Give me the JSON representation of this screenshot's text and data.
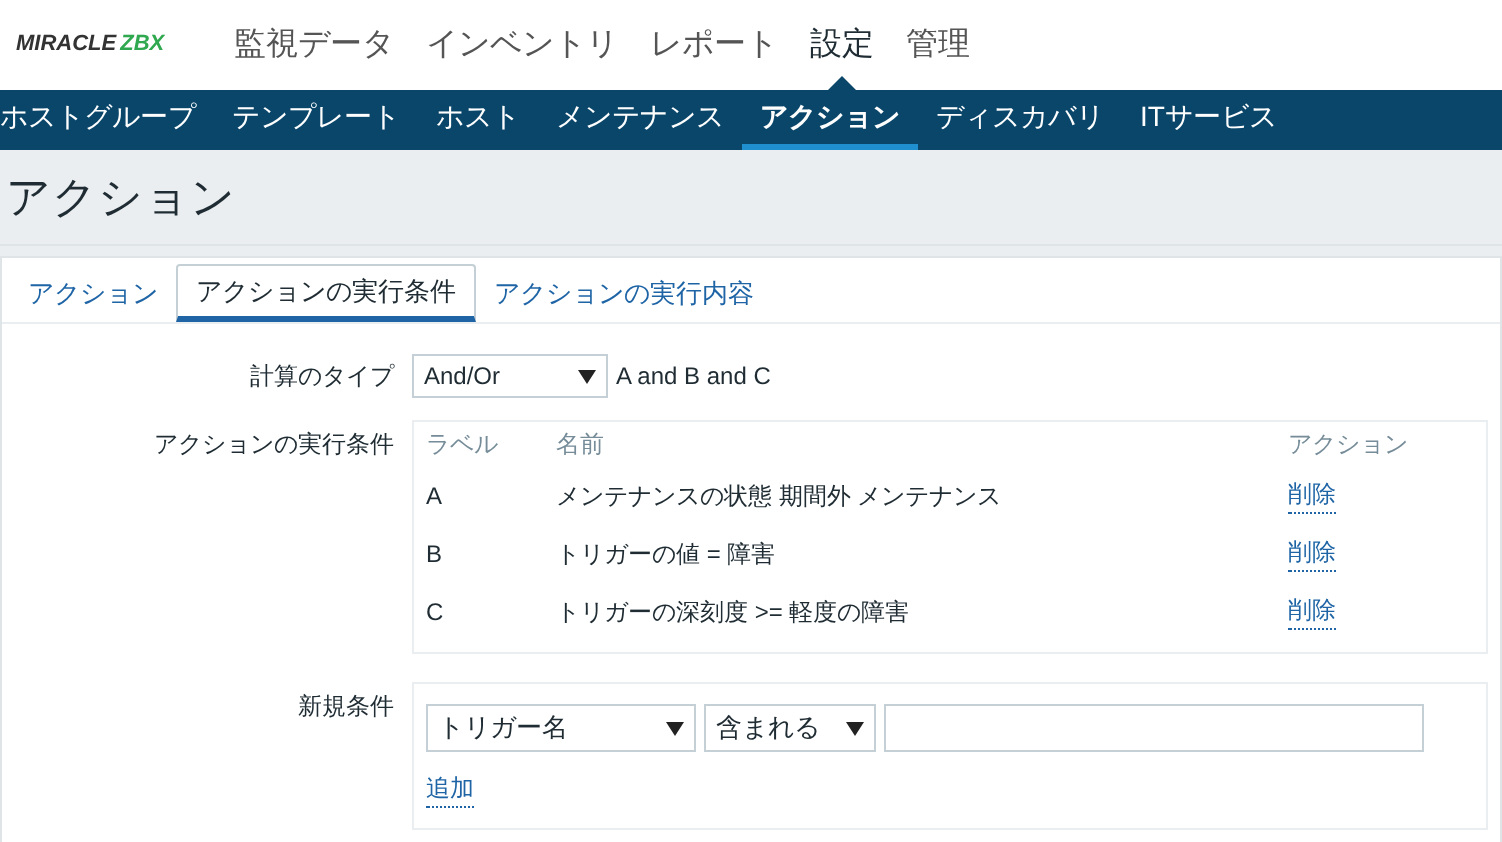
{
  "logo": {
    "part_1": "MIRACLE",
    "part_2": "ZBX"
  },
  "main_menu": [
    {
      "label": "監視データ",
      "selected": false
    },
    {
      "label": "インベントリ",
      "selected": false
    },
    {
      "label": "レポート",
      "selected": false
    },
    {
      "label": "設定",
      "selected": true
    },
    {
      "label": "管理",
      "selected": false
    }
  ],
  "sub_menu": [
    {
      "label": "ホストグループ",
      "selected": false
    },
    {
      "label": "テンプレート",
      "selected": false
    },
    {
      "label": "ホスト",
      "selected": false
    },
    {
      "label": "メンテナンス",
      "selected": false
    },
    {
      "label": "アクション",
      "selected": true
    },
    {
      "label": "ディスカバリ",
      "selected": false
    },
    {
      "label": "ITサービス",
      "selected": false
    }
  ],
  "page_title": "アクション",
  "tabs": [
    {
      "label": "アクション",
      "selected": false
    },
    {
      "label": "アクションの実行条件",
      "selected": true
    },
    {
      "label": "アクションの実行内容",
      "selected": false
    }
  ],
  "calc_type": {
    "label": "計算のタイプ",
    "value": "And/Or",
    "formula": "A and B and C"
  },
  "conditions": {
    "label": "アクションの実行条件",
    "columns": [
      "ラベル",
      "名前",
      "アクション"
    ],
    "rows": [
      {
        "label": "A",
        "name": "メンテナンスの状態 期間外 メンテナンス",
        "action": "削除"
      },
      {
        "label": "B",
        "name": "トリガーの値 = 障害",
        "action": "削除"
      },
      {
        "label": "C",
        "name": "トリガーの深刻度 >= 軽度の障害",
        "action": "削除"
      }
    ]
  },
  "new_condition": {
    "label": "新規条件",
    "type": "トリガー名",
    "operator": "含まれる",
    "add": "追加"
  }
}
